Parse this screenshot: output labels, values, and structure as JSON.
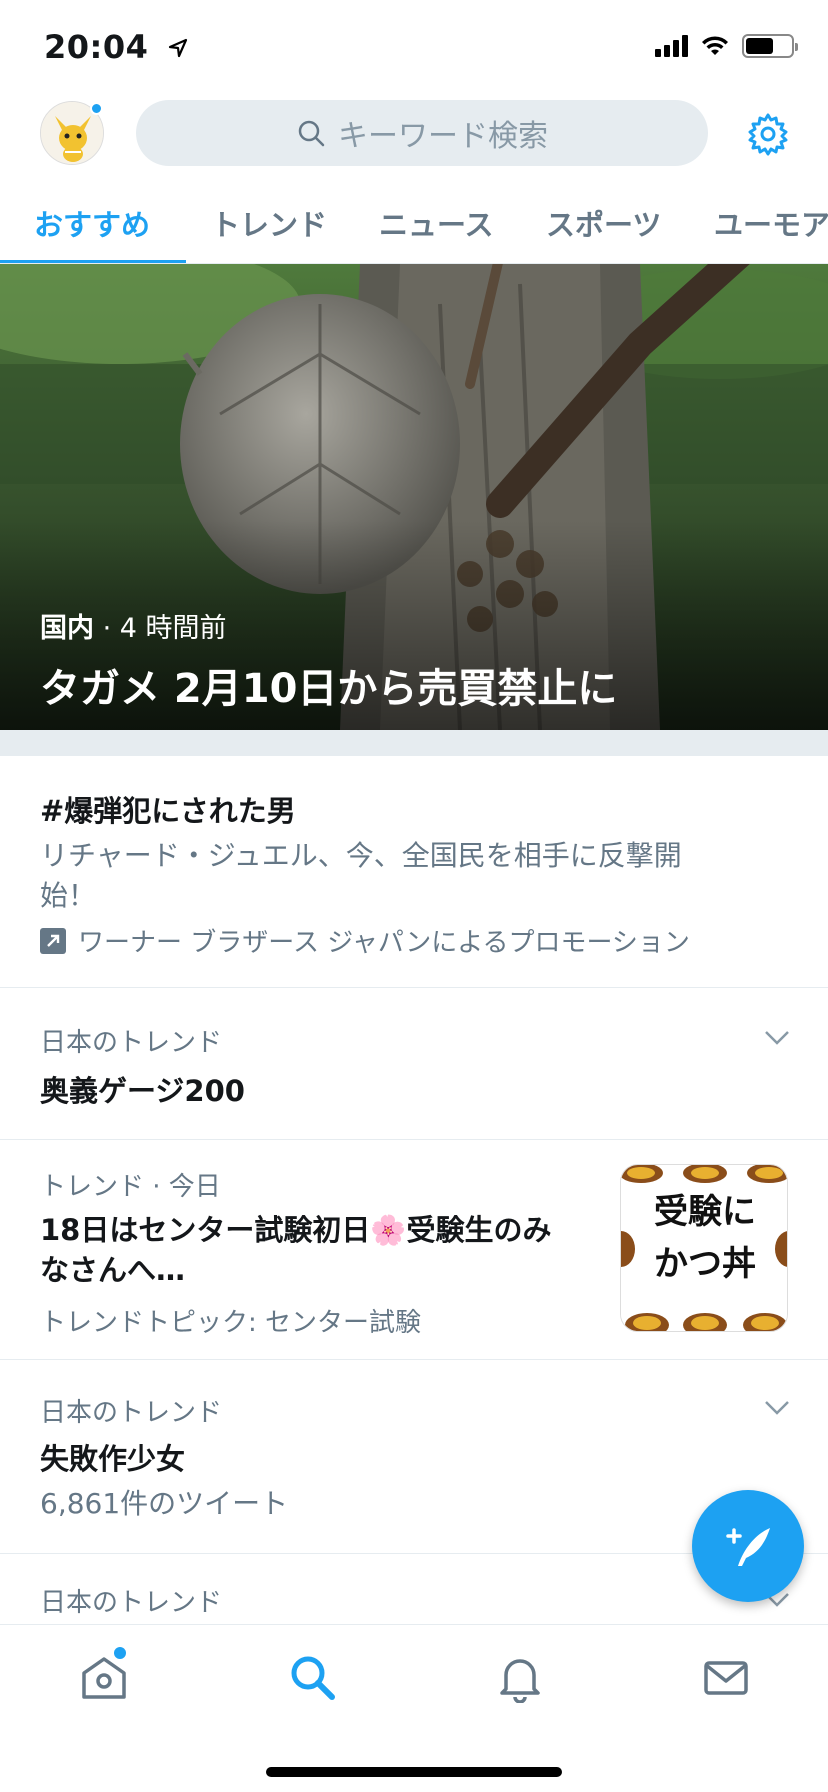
{
  "status_bar": {
    "time": "20:04"
  },
  "header": {
    "search_placeholder": "キーワード検索"
  },
  "tabs": [
    {
      "label": "おすすめ"
    },
    {
      "label": "トレンド"
    },
    {
      "label": "ニュース"
    },
    {
      "label": "スポーツ"
    },
    {
      "label": "ユーモア"
    }
  ],
  "hero": {
    "category": "国内",
    "separator": "·",
    "time": "4 時間前",
    "title": "タガメ 2月10日から売買禁止に"
  },
  "promo": {
    "title": "#爆弾犯にされた男",
    "description": "リチャード・ジュエル、今、全国民を相手に反撃開始！",
    "promoted_by": "ワーナー ブラザース ジャパンによるプロモーション"
  },
  "trends": [
    {
      "label": "日本のトレンド",
      "title": "奥義ゲージ200"
    },
    {
      "label": "トレンド · 今日",
      "title": "18日はセンター試験初日🌸受験生のみなさんへ…",
      "sub": "トレンドトピック: センター試験",
      "thumb_lines": [
        "受験に",
        "かつ丼"
      ]
    },
    {
      "label": "日本のトレンド",
      "title": "失敗作少女",
      "sub": "6,861件のツイート"
    },
    {
      "label": "日本のトレンド"
    }
  ],
  "colors": {
    "accent": "#1da1f2",
    "muted": "#657786",
    "border": "#e6ecf0"
  }
}
